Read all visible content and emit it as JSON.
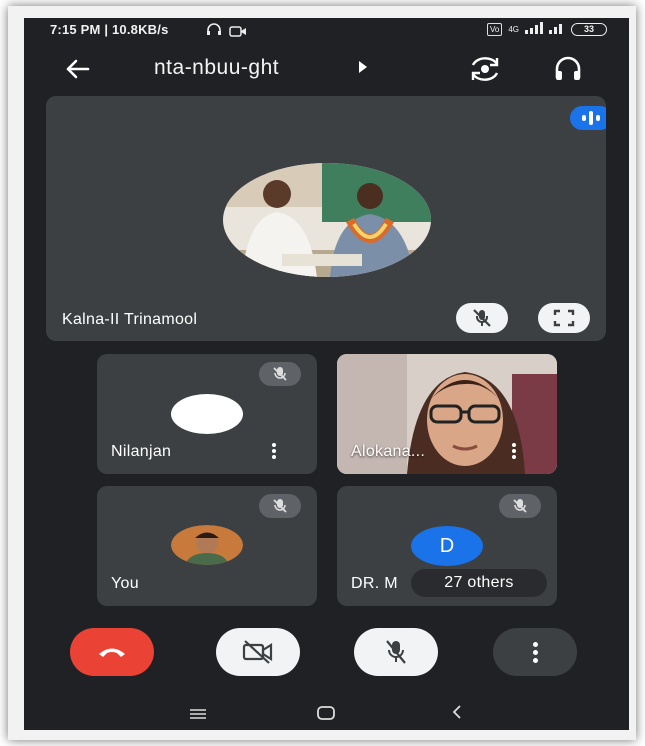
{
  "status_bar": {
    "time_speed": "7:15 PM | 10.8KB/s",
    "network_label": "4G",
    "battery": "33"
  },
  "app_bar": {
    "meeting_code": "nta-nbuu-ght",
    "icons": [
      "back-arrow-icon",
      "caret-right-icon",
      "switch-camera-icon",
      "headphones-icon"
    ]
  },
  "main_tile": {
    "participant_name": "Kalna-II Trinamool",
    "icons": [
      "speaking-indicator-icon",
      "mic-off-icon",
      "fullscreen-icon"
    ]
  },
  "tiles": [
    {
      "name": "Nilanjan",
      "muted": true
    },
    {
      "name": "Alokana...",
      "muted": false
    },
    {
      "name": "You",
      "muted": true
    },
    {
      "name": "DR. M",
      "muted": true,
      "avatar_letter": "D",
      "overflow_label": "27 others"
    }
  ],
  "controls": {
    "icons": [
      "end-call-icon",
      "camera-off-icon",
      "mic-off-icon",
      "more-options-icon"
    ]
  },
  "colors": {
    "background": "#202124",
    "tile": "#3c4043",
    "end_call": "#ea4335",
    "accent_blue": "#1a73e8"
  }
}
